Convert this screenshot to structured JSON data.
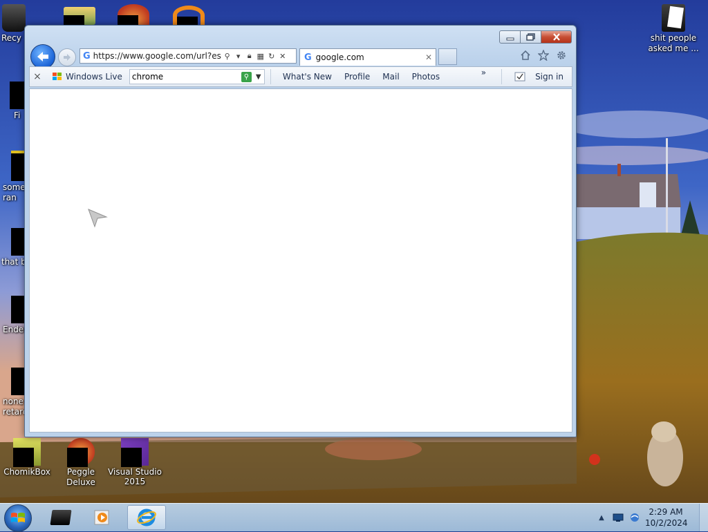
{
  "desktop": {
    "left_icons": [
      {
        "label": "Recy"
      },
      {
        "label": "Fi"
      },
      {
        "label": "some\nran"
      },
      {
        "label": "that b"
      },
      {
        "label": "Ender"
      },
      {
        "label": "none\nretarc"
      }
    ],
    "bottom_icons": [
      {
        "label": "ChomikBox"
      },
      {
        "label": "Peggle Deluxe"
      },
      {
        "label": "Visual Studio 2015"
      }
    ],
    "right_icon": {
      "label": "shit people asked me ..."
    }
  },
  "browser": {
    "address_url": "https://www.google.com/url?esrc=",
    "tab_title": "google.com",
    "toolbar": {
      "close_label": "×",
      "windows_live_label": "Windows Live",
      "search_value": "chrome",
      "links": [
        "What's New",
        "Profile",
        "Mail",
        "Photos"
      ],
      "more_label": "»",
      "signin_label": "Sign in"
    }
  },
  "taskbar": {
    "time": "2:29 AM",
    "date": "10/2/2024"
  },
  "colors": {
    "accent": "#1a62d6",
    "window_frame": "#bcd2ea",
    "close_button": "#c74e34"
  }
}
